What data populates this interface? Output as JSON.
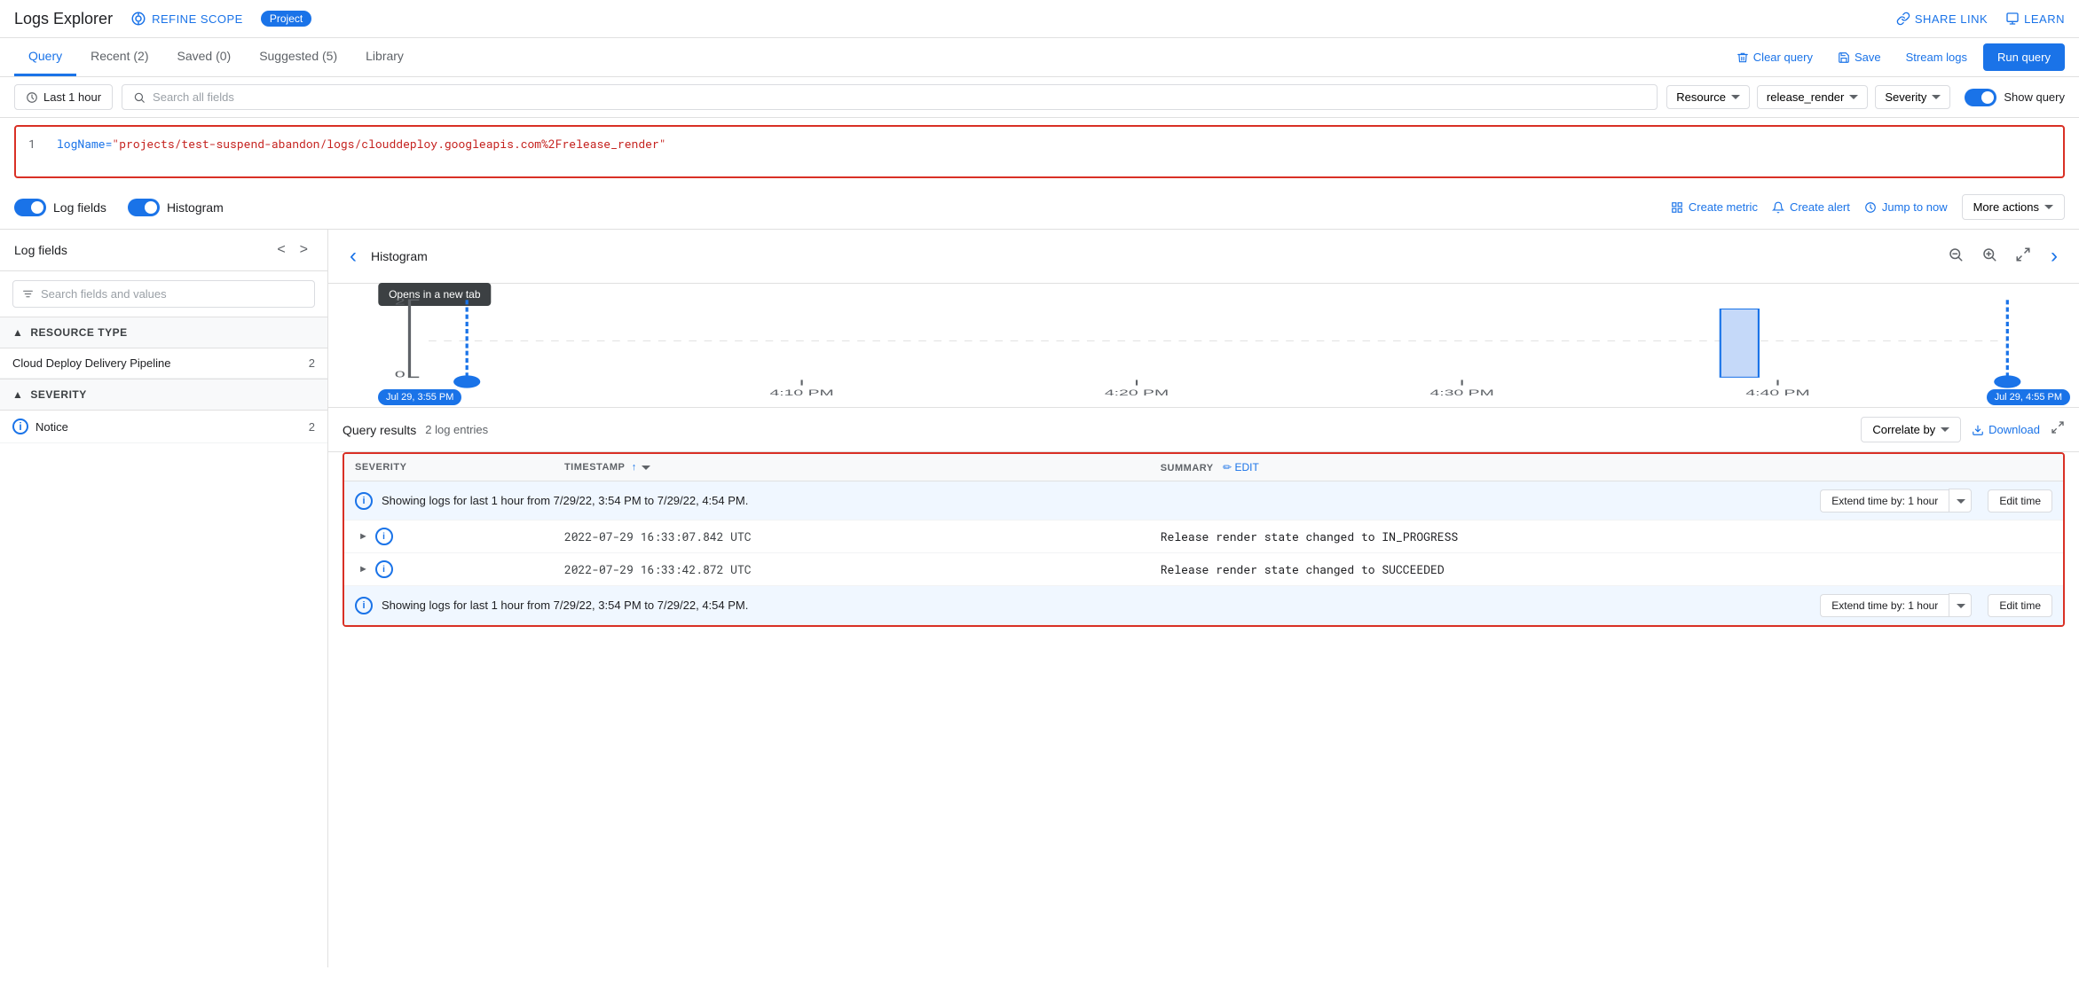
{
  "app": {
    "title": "Logs Explorer",
    "refine_scope": "REFINE SCOPE",
    "project_badge": "Project",
    "share_link": "SHARE LINK",
    "learn": "LEARN"
  },
  "tabs": {
    "items": [
      {
        "label": "Query",
        "active": true
      },
      {
        "label": "Recent (2)",
        "active": false
      },
      {
        "label": "Saved (0)",
        "active": false
      },
      {
        "label": "Suggested (5)",
        "active": false
      },
      {
        "label": "Library",
        "active": false
      }
    ],
    "clear_query": "Clear query",
    "save": "Save",
    "stream_logs": "Stream logs",
    "run_query": "Run query"
  },
  "query_toolbar": {
    "time_label": "Last 1 hour",
    "search_placeholder": "Search all fields",
    "resource_label": "Resource",
    "log_name_label": "release_render",
    "severity_label": "Severity",
    "show_query_label": "Show query"
  },
  "query_editor": {
    "line_number": "1",
    "query": "logName=\"projects/test-suspend-abandon/logs/clouddeploy.googleapis.com%2Frelease_render\""
  },
  "controls": {
    "log_fields_label": "Log fields",
    "histogram_label": "Histogram",
    "create_metric": "Create metric",
    "create_alert": "Create alert",
    "jump_to_now": "Jump to now",
    "more_actions": "More actions"
  },
  "log_fields_panel": {
    "title": "Log fields",
    "search_placeholder": "Search fields and values",
    "sections": [
      {
        "title": "RESOURCE TYPE",
        "items": [
          {
            "label": "Cloud Deploy Delivery Pipeline",
            "count": "2"
          }
        ]
      },
      {
        "title": "SEVERITY",
        "items": [
          {
            "label": "Notice",
            "count": "2",
            "icon": "i"
          }
        ]
      }
    ]
  },
  "histogram": {
    "title": "Histogram",
    "tooltip": "Opens in a new tab",
    "y_max": "2",
    "y_min": "0",
    "time_start": "Jul 29, 3:55 PM",
    "time_labels": [
      "4:10 PM",
      "4:20 PM",
      "4:30 PM",
      "4:40 PM"
    ],
    "time_end": "Jul 29, 4:55 PM"
  },
  "query_results": {
    "title": "Query results",
    "count": "2 log entries",
    "correlate_by": "Correlate by",
    "download": "Download",
    "table_headers": {
      "severity": "SEVERITY",
      "timestamp": "TIMESTAMP",
      "summary": "SUMMARY",
      "edit": "EDIT"
    },
    "info_bar_top": {
      "text": "Showing logs for last 1 hour from 7/29/22, 3:54 PM to 7/29/22, 4:54 PM.",
      "extend_btn": "Extend time by: 1 hour",
      "edit_time": "Edit time"
    },
    "log_entries": [
      {
        "severity_icon": "i",
        "timestamp": "2022-07-29 16:33:07.842 UTC",
        "summary": "Release render state changed to  IN_PROGRESS"
      },
      {
        "severity_icon": "i",
        "timestamp": "2022-07-29 16:33:42.872 UTC",
        "summary": "Release render state changed to  SUCCEEDED"
      }
    ],
    "info_bar_bottom": {
      "text": "Showing logs for last 1 hour from 7/29/22, 3:54 PM to 7/29/22, 4:54 PM.",
      "extend_btn": "Extend time by: 1 hour",
      "edit_time": "Edit time"
    }
  }
}
